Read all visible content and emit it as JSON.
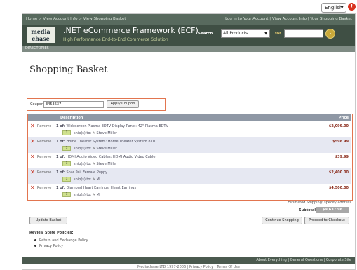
{
  "language": {
    "selected": "English"
  },
  "topnav": {
    "home": "Home",
    "sep": " > ",
    "account": "View Account Info",
    "basket": "View Shopping Basket",
    "links": [
      "Log In to Your Account",
      "View Account Info",
      "Your Shopping Basket"
    ],
    "divider": " | "
  },
  "brand": {
    "logo_line1": "media",
    "logo_line2": "chase",
    "title": ".NET eCommerce Framework (ECF)",
    "subtitle": "High Performance End-to-End Commerce Solution"
  },
  "search": {
    "label": "Search",
    "category": "All Products",
    "for_label": "for",
    "go": "›"
  },
  "directories": "DIRECTORIES",
  "page_title": "Shopping Basket",
  "coupon": {
    "label": "Coupon:",
    "value": "3453637",
    "button": "Apply Coupon"
  },
  "basket": {
    "col_description": "Description",
    "col_price": "Price",
    "remove_label": "Remove",
    "ship_label": "ship(s) to:",
    "items": [
      {
        "qty_text": "1 of:",
        "desc": "Widescreen Plasma EDTV Display Panel: 42\" Plasma EDTV",
        "price": "$2,099.00",
        "qty": "1",
        "ship_to": "Steve Miller"
      },
      {
        "qty_text": "1 of:",
        "desc": "Home Theater System: Home Theater System 810",
        "price": "$598.99",
        "qty": "1",
        "ship_to": "Steve Miller"
      },
      {
        "qty_text": "1 of:",
        "desc": "HDMI Audio Video Cables: HDMI Audio Video Cable",
        "price": "$39.99",
        "qty": "1",
        "ship_to": "Steve Miller"
      },
      {
        "qty_text": "1 of:",
        "desc": "Shar Pei: Female Puppy",
        "price": "$2,400.00",
        "qty": "1",
        "ship_to": "Mi"
      },
      {
        "qty_text": "1 of:",
        "desc": "Diamond Heart Earrings: Heart Earrings",
        "price": "$4,500.00",
        "qty": "1",
        "ship_to": "Mi"
      }
    ]
  },
  "estimated_shipping": "Estimated Shipping: specify address",
  "subtotal": {
    "label": "Subtotal:",
    "value": "$9,637.98"
  },
  "buttons": {
    "update": "Update Basket",
    "continue": "Continue Shopping",
    "checkout": "Proceed to Checkout"
  },
  "policies": {
    "title": "Review Store Policies:",
    "items": [
      "Return and Exchange Policy",
      "Privacy Policy"
    ]
  },
  "footer": {
    "links": [
      "About Everything",
      "General Questions",
      "Corporate Site"
    ],
    "divider": " | ",
    "copyright": "Mediachase LTD 1997-2006",
    "privacy": "Privacy Policy",
    "terms": "Terms Of Use"
  },
  "colors": {
    "nav_bg": "#586a5e",
    "banner_bg": "#3f4f44",
    "highlight_border": "#e2754f",
    "price_color": "#8a2a1a",
    "remove_color": "#c52b18"
  },
  "icons": {
    "remove": "close-x-icon",
    "ship_edit": "pencil-icon",
    "go": "go-arrow-icon",
    "help": "help-icon",
    "bullet": "bullet-icon"
  }
}
